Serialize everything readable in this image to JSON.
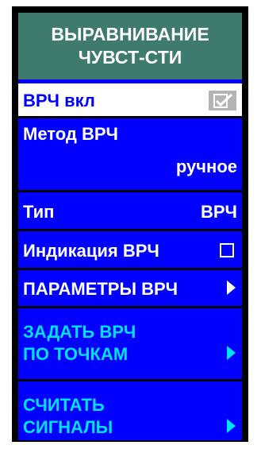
{
  "title": {
    "line1": "ВЫРАВНИВАНИЕ",
    "line2": "ЧУВСТ-СТИ"
  },
  "items": [
    {
      "label": "ВРЧ вкл",
      "checked": true
    },
    {
      "label": "Метод ВРЧ",
      "value": "ручное"
    },
    {
      "label": "Тип",
      "value": "ВРЧ"
    },
    {
      "label": "Индикация ВРЧ",
      "checked": false
    },
    {
      "label": "ПАРАМЕТРЫ ВРЧ"
    },
    {
      "line1": "ЗАДАТЬ ВРЧ",
      "line2": "ПО ТОЧКАМ"
    },
    {
      "line1": "СЧИТАТЬ",
      "line2": "СИГНАЛЫ"
    }
  ],
  "colors": {
    "title_bg": "#3f7a6e",
    "menu_bg": "#0000ff",
    "submenu_text": "#00e0ff",
    "selected_bg": "#ffffff"
  },
  "icons": [
    "checkmark-icon",
    "checkbox-icon",
    "arrow-right-icon"
  ]
}
